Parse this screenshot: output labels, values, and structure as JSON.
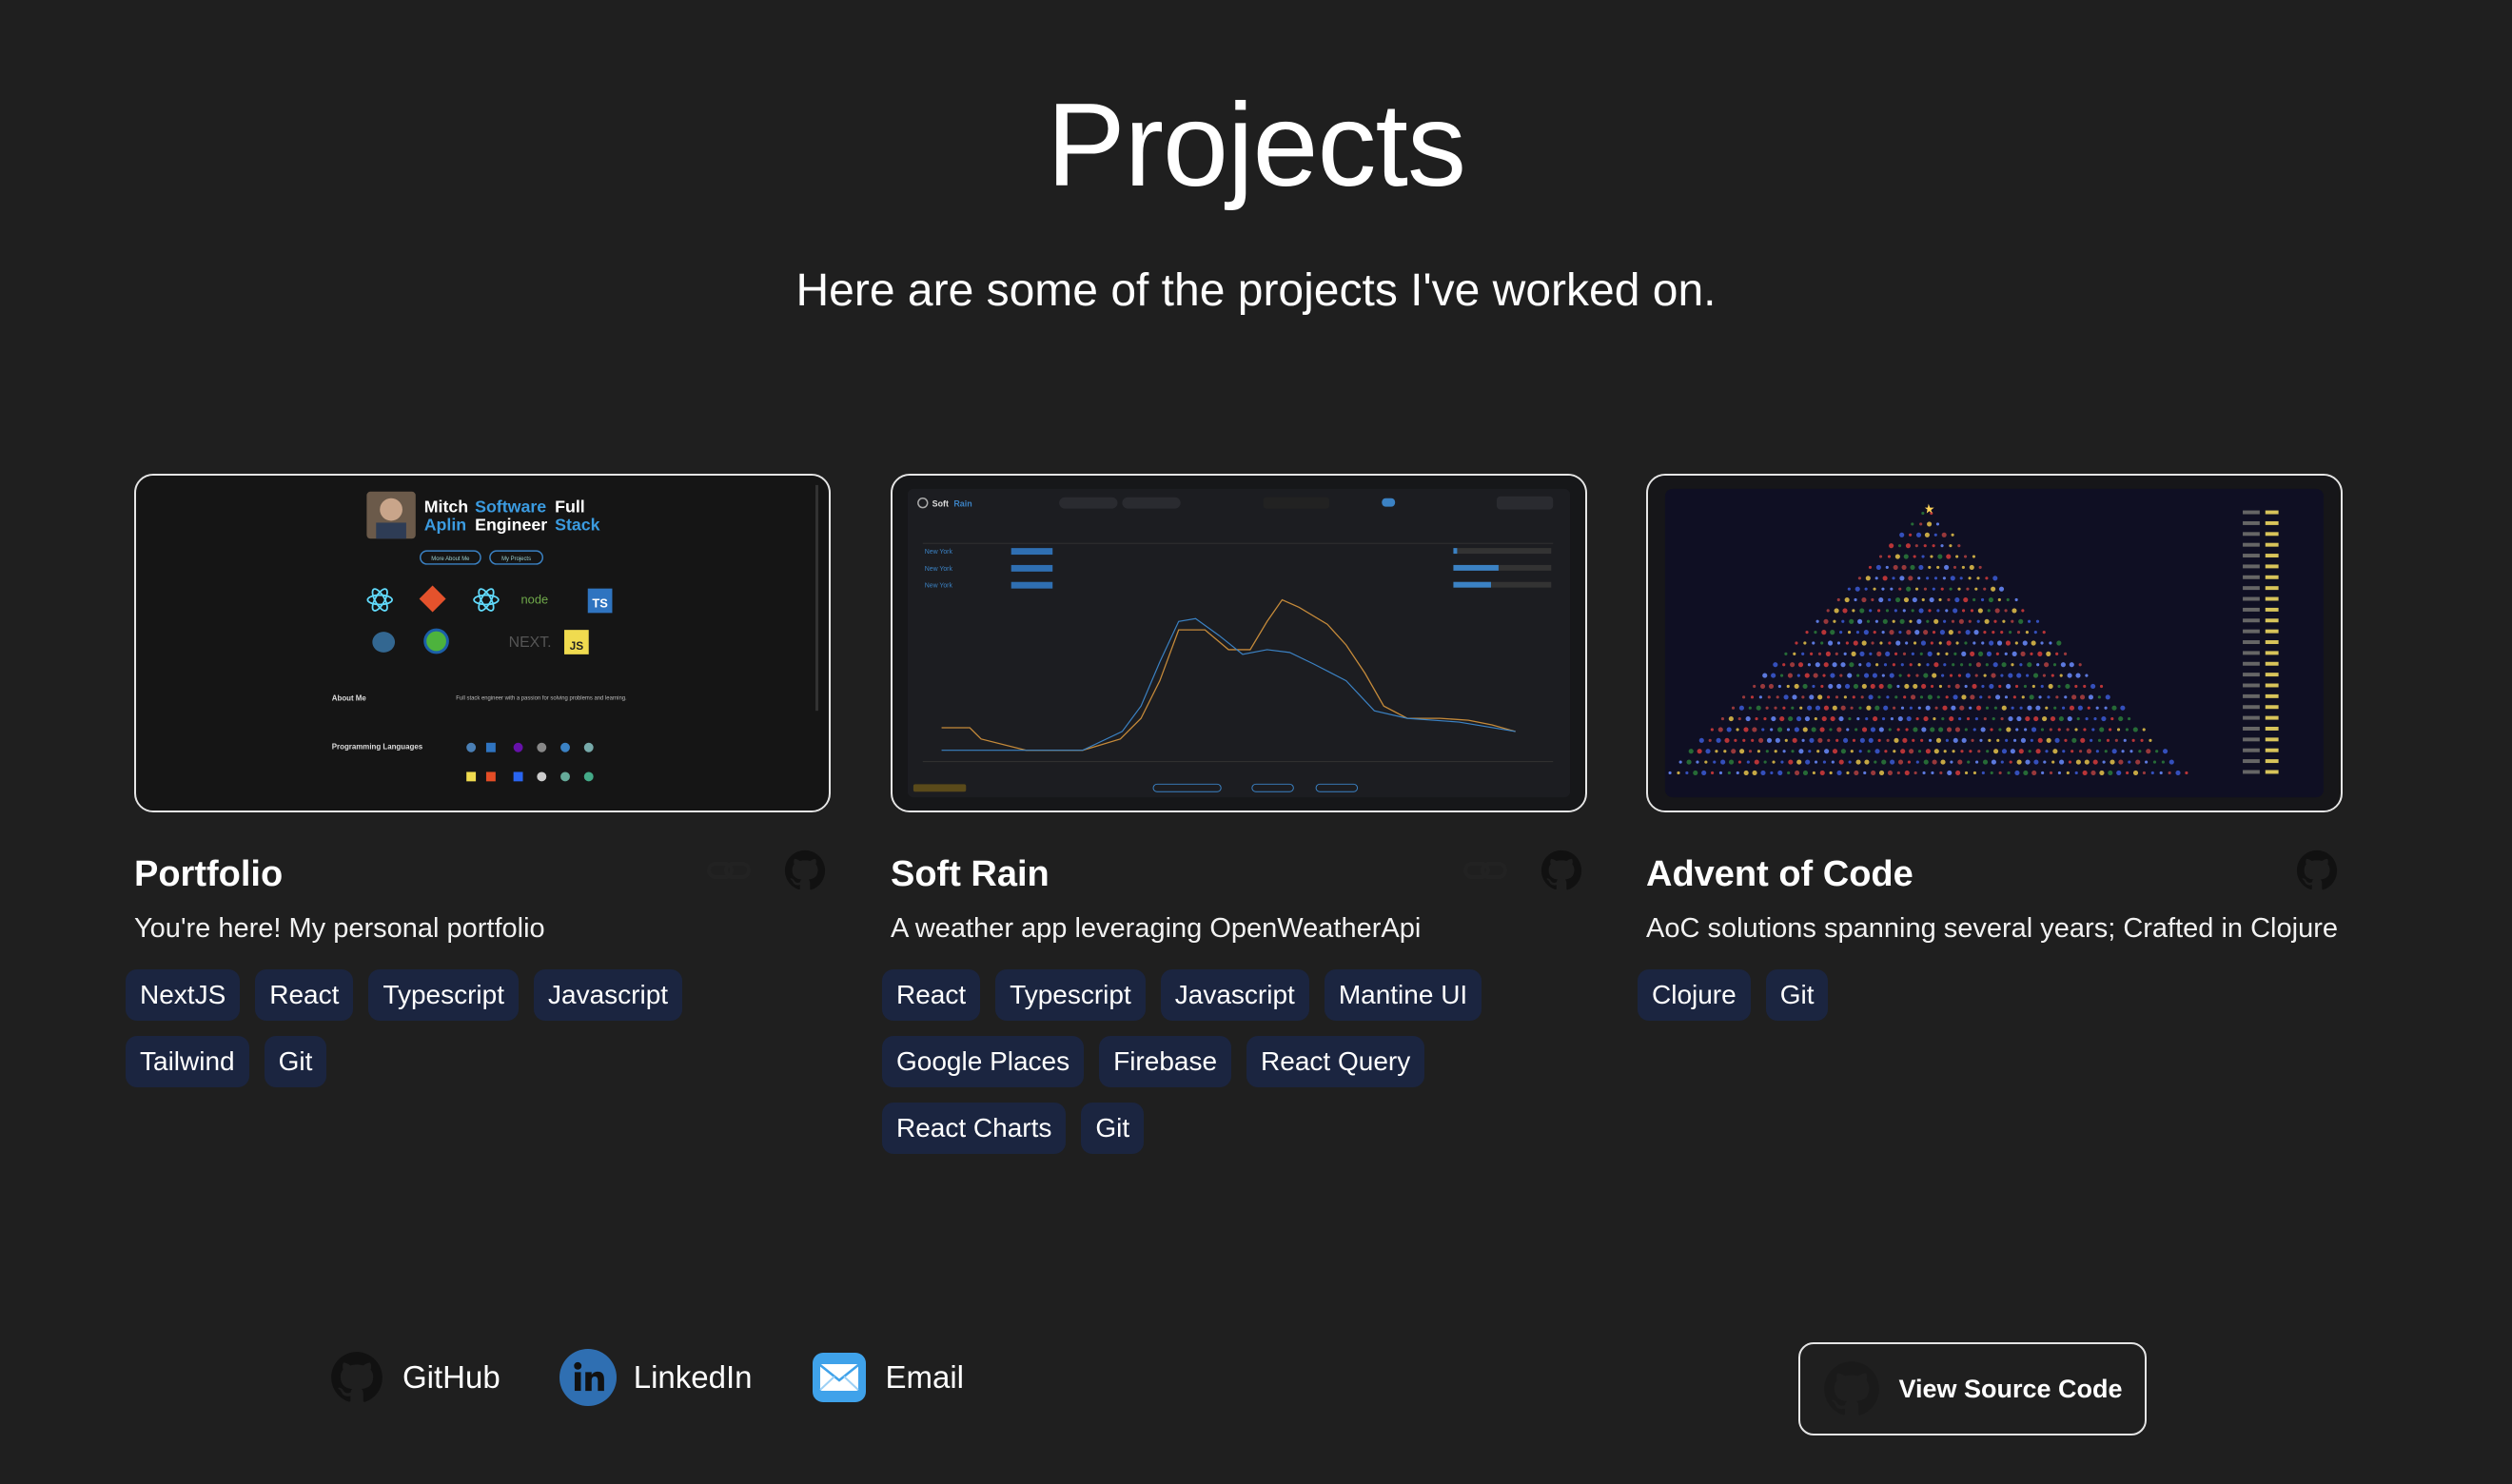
{
  "page": {
    "title": "Projects",
    "subtitle": "Here are some of the projects I've worked on."
  },
  "projects": [
    {
      "title": "Portfolio",
      "description": "You're here! My personal portfolio",
      "icons": [
        "link-icon",
        "github-icon"
      ],
      "tags": [
        "NextJS",
        "React",
        "Typescript",
        "Javascript",
        "Tailwind",
        "Git"
      ],
      "preview": {
        "name_first": "Mitch",
        "name_last": "Aplin",
        "role_1": "Software",
        "role_2": "Engineer",
        "role_3": "Full",
        "role_4": "Stack",
        "btn_1": "More About Me",
        "btn_2": "My Projects",
        "about_label": "About Me",
        "about_text": "Full stack engineer with a passion for solving problems and learning.",
        "languages_label": "Programming Languages",
        "next_label": "NEXT.",
        "ts_label": "TS",
        "js_label": "JS",
        "node_label": "node"
      }
    },
    {
      "title": "Soft Rain",
      "description": "A weather app leveraging OpenWeatherApi",
      "icons": [
        "link-icon",
        "github-icon"
      ],
      "tags": [
        "React",
        "Typescript",
        "Javascript",
        "Mantine UI",
        "Google Places",
        "Firebase",
        "React Query",
        "React Charts",
        "Git"
      ],
      "preview": {
        "brand_1": "Soft",
        "brand_2": "Rain",
        "cities": [
          "New York",
          "New York",
          "New York"
        ]
      }
    },
    {
      "title": "Advent of Code",
      "description": "AoC solutions spanning several years; Crafted in Clojure",
      "icons": [
        "github-icon"
      ],
      "tags": [
        "Clojure",
        "Git"
      ]
    }
  ],
  "footer": {
    "links": [
      {
        "label": "GitHub",
        "icon": "github-icon"
      },
      {
        "label": "LinkedIn",
        "icon": "linkedin-icon"
      },
      {
        "label": "Email",
        "icon": "email-icon"
      }
    ],
    "source_button": "View Source Code"
  },
  "colors": {
    "background": "#1f1f1f",
    "tag_bg": "#1b2540",
    "accent_blue": "#3b82c4",
    "linkedin": "#2f6fb2"
  }
}
